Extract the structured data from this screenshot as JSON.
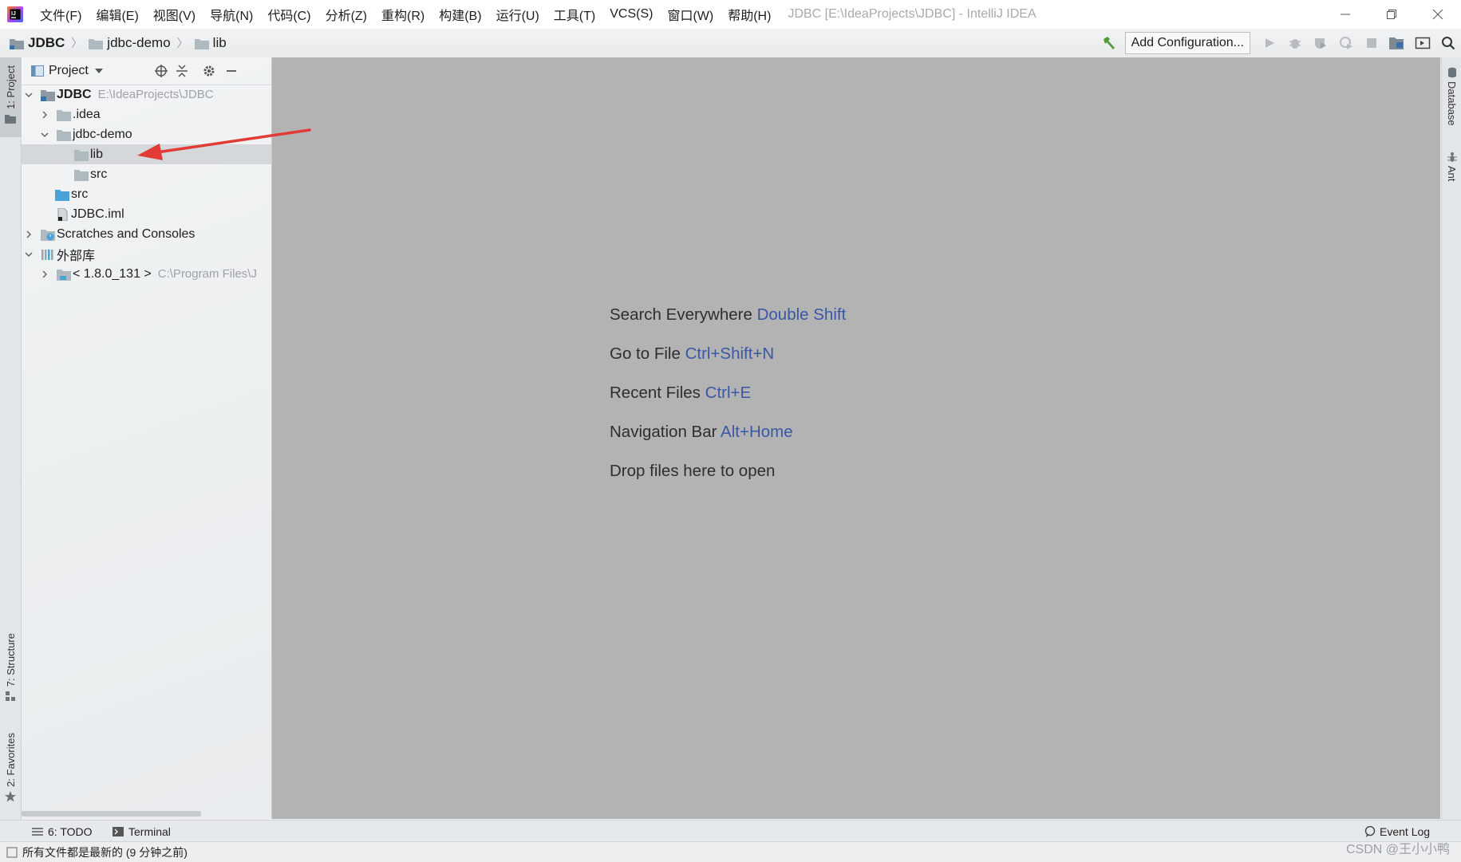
{
  "titlebar": {
    "menu": [
      "文件(F)",
      "编辑(E)",
      "视图(V)",
      "导航(N)",
      "代码(C)",
      "分析(Z)",
      "重构(R)",
      "构建(B)",
      "运行(U)",
      "工具(T)",
      "VCS(S)",
      "窗口(W)",
      "帮助(H)"
    ],
    "window_title": "JDBC [E:\\IdeaProjects\\JDBC] - IntelliJ IDEA"
  },
  "breadcrumb": [
    "JDBC",
    "jdbc-demo",
    "lib"
  ],
  "toolbar": {
    "add_configuration": "Add Configuration..."
  },
  "left_stripe": {
    "project": "1: Project",
    "structure": "7: Structure",
    "favorites": "2: Favorites"
  },
  "right_stripe": {
    "database": "Database",
    "ant": "Ant"
  },
  "project_panel": {
    "title": "Project",
    "tree": [
      {
        "label": "JDBC",
        "path": "E:\\IdeaProjects\\JDBC"
      },
      {
        "label": ".idea"
      },
      {
        "label": "jdbc-demo"
      },
      {
        "label": "lib"
      },
      {
        "label": "src"
      },
      {
        "label": "src"
      },
      {
        "label": "JDBC.iml"
      },
      {
        "label": "Scratches and Consoles"
      },
      {
        "label": "外部库"
      },
      {
        "label": "< 1.8.0_131 >",
        "path": "C:\\Program Files\\J"
      }
    ]
  },
  "editor": {
    "hints": [
      {
        "text": "Search Everywhere",
        "key": "Double Shift"
      },
      {
        "text": "Go to File",
        "key": "Ctrl+Shift+N"
      },
      {
        "text": "Recent Files",
        "key": "Ctrl+E"
      },
      {
        "text": "Navigation Bar",
        "key": "Alt+Home"
      },
      {
        "text": "Drop files here to open",
        "key": ""
      }
    ]
  },
  "bottom_tabs": {
    "todo": "6: TODO",
    "terminal": "Terminal",
    "event_log": "Event Log"
  },
  "status": {
    "text": "所有文件都是最新的 (9 分钟之前)"
  },
  "watermark": "CSDN @王小小鸭",
  "colors": {
    "editor_bg": "#b3b3b3",
    "shortcut_key": "#3a57a6",
    "folder": "#aeb9c0",
    "source_folder": "#4aa3d8",
    "annotation_arrow": "#e23b35"
  }
}
